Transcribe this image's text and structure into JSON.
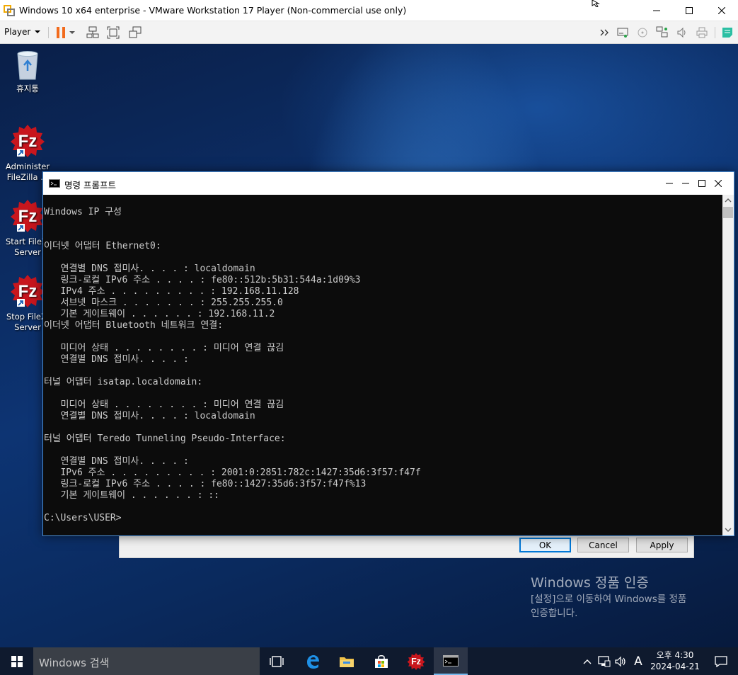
{
  "vm": {
    "title": "Windows 10 x64 enterprise - VMware Workstation 17 Player (Non-commercial use only)",
    "player_menu": "Player"
  },
  "desktop": {
    "icons": [
      {
        "label1": "휴지통",
        "label2": ""
      },
      {
        "label1": "Administer",
        "label2": "FileZilla ..."
      },
      {
        "label1": "Start FileZi",
        "label2": "Server"
      },
      {
        "label1": "Stop FileZi",
        "label2": "Server"
      }
    ]
  },
  "dialog": {
    "ok": "OK",
    "cancel": "Cancel",
    "apply": "Apply"
  },
  "cmd": {
    "title": "명령 프롬프트",
    "lines": [
      "Windows IP 구성",
      "",
      "",
      "이더넷 어댑터 Ethernet0:",
      "",
      "   연결별 DNS 접미사. . . . : localdomain",
      "   링크-로컬 IPv6 주소 . . . . : fe80::512b:5b31:544a:1d09%3",
      "   IPv4 주소 . . . . . . . . . : 192.168.11.128",
      "   서브넷 마스크 . . . . . . . : 255.255.255.0",
      "   기본 게이트웨이 . . . . . . : 192.168.11.2",
      "이더넷 어댑터 Bluetooth 네트워크 연결:",
      "",
      "   미디어 상태 . . . . . . . . : 미디어 연결 끊김",
      "   연결별 DNS 접미사. . . . :",
      "",
      "터널 어댑터 isatap.localdomain:",
      "",
      "   미디어 상태 . . . . . . . . : 미디어 연결 끊김",
      "   연결별 DNS 접미사. . . . : localdomain",
      "",
      "터널 어댑터 Teredo Tunneling Pseudo-Interface:",
      "",
      "   연결별 DNS 접미사. . . . :",
      "   IPv6 주소 . . . . . . . . . : 2001:0:2851:782c:1427:35d6:3f57:f47f",
      "   링크-로컬 IPv6 주소 . . . . : fe80::1427:35d6:3f57:f47f%13",
      "   기본 게이트웨이 . . . . . . : ::",
      "",
      "C:\\Users\\USER>"
    ]
  },
  "activation": {
    "title": "Windows 정품 인증",
    "line1": "[설정]으로 이동하여 Windows를 정품",
    "line2": "인증합니다."
  },
  "taskbar": {
    "search_placeholder": "Windows 검색",
    "ime": "A",
    "time": "오후 4:30",
    "date": "2024-04-21"
  }
}
